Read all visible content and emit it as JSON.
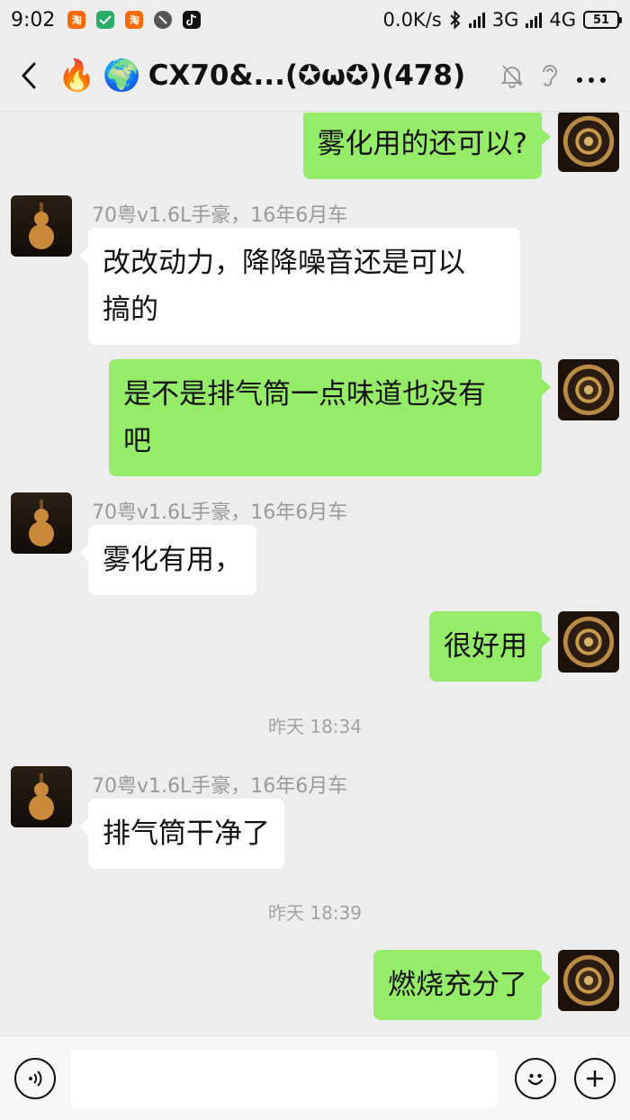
{
  "status_bar": {
    "time": "9:02",
    "notification_icons": [
      "taobao-icon",
      "wechat-pay-icon",
      "taobao-icon",
      "block-icon",
      "tiktok-icon"
    ],
    "network_speed": "0.0K/s",
    "network_3g": "3G",
    "network_4g": "4G",
    "battery": "51"
  },
  "header": {
    "title_prefix_emojis": [
      "🔥",
      "🌍"
    ],
    "title": "CX70&...(✪ω✪)(478)",
    "mute_icon": "bell-off-icon",
    "ear_icon": "ear-icon",
    "more_icon": "more-dots-icon"
  },
  "messages": [
    {
      "side": "right",
      "text": "雾化用的还可以?"
    },
    {
      "side": "left",
      "sender": "70粤v1.6L手豪，16年6月车",
      "lines": [
        "改改动力，降降噪音还是可以",
        "搞的"
      ]
    },
    {
      "side": "right",
      "lines": [
        "是不是排气筒一点味道也没有",
        "吧"
      ]
    },
    {
      "side": "left",
      "sender": "70粤v1.6L手豪，16年6月车",
      "text": "雾化有用，"
    },
    {
      "side": "right",
      "text": "很好用"
    },
    {
      "type": "timestamp",
      "text": "昨天 18:34"
    },
    {
      "side": "left",
      "sender": "70粤v1.6L手豪，16年6月车",
      "text": "排气筒干净了"
    },
    {
      "type": "timestamp",
      "text": "昨天 18:39"
    },
    {
      "side": "right",
      "text": "燃烧充分了"
    }
  ],
  "input_bar": {
    "voice_icon": "voice-icon",
    "emoji_icon": "emoji-icon",
    "plus_icon": "plus-icon",
    "placeholder": ""
  },
  "colors": {
    "background": "#ededed",
    "green_bubble": "#95ec69",
    "white_bubble": "#ffffff",
    "meta_text": "#9a9a9a"
  }
}
